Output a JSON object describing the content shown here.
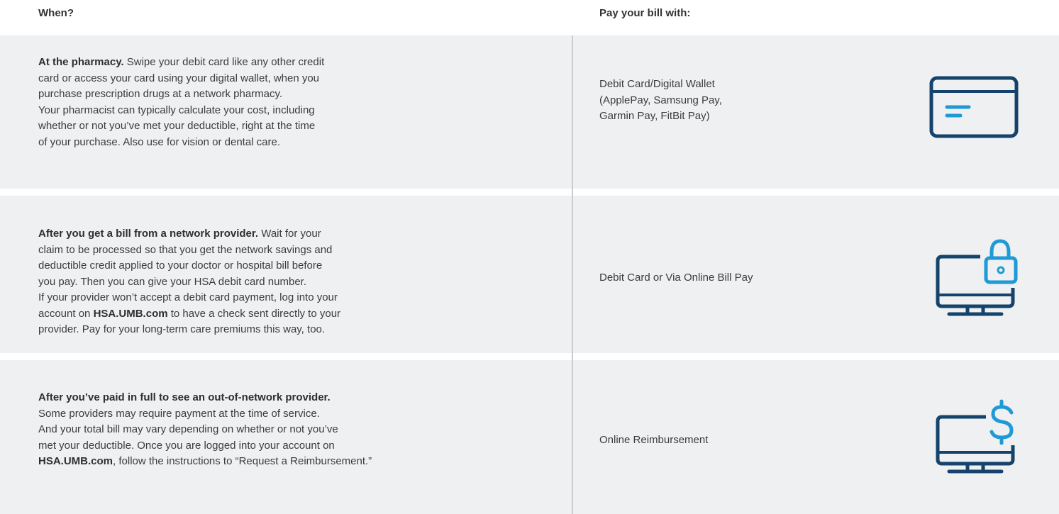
{
  "header": {
    "when": "When?",
    "pay_with": "Pay your bill with:"
  },
  "rows": [
    {
      "lead": "At the pharmacy.",
      "text": " Swipe your debit card like any other credit\ncard or access your card using your digital wallet, when you\npurchase prescription drugs at a network pharmacy.\nYour pharmacist can typically calculate your cost, including\nwhether or not you’ve met your deductible, right at the time\nof your purchase. Also use for vision or dental care.",
      "method": "Debit Card/Digital Wallet\n(ApplePay, Samsung Pay,\nGarmin Pay, FitBit Pay)",
      "icon": "credit-card-icon"
    },
    {
      "lead": "After you get a bill from a network provider.",
      "text_a": " Wait for your\nclaim to be processed so that you get the network savings and\ndeductible credit applied to your doctor or hospital bill before\nyou pay. Then you can give your HSA debit card number.\nIf your provider won’t accept a debit card payment, log into your\naccount on ",
      "link": "HSA.UMB.com",
      "text_b": " to have a check sent directly to your\nprovider. Pay for your long-term care premiums this way, too.",
      "method": "Debit Card or Via Online Bill Pay",
      "icon": "computer-lock-icon"
    },
    {
      "lead": "After you’ve paid in full to see an out-of-network provider.",
      "text_a": "\nSome providers may require payment at the time of service.\nAnd your total bill may vary depending on whether or not you’ve\nmet your deductible. Once you are logged into your account on\n",
      "link": "HSA.UMB.com",
      "text_b": ", follow the instructions to “Request a Reimbursement.”",
      "method": "Online Reimbursement",
      "icon": "computer-dollar-icon"
    }
  ],
  "colors": {
    "navy": "#15436b",
    "blue": "#1f9ad6",
    "row_bg": "#eef0f1",
    "divider": "#c9cbcd"
  }
}
